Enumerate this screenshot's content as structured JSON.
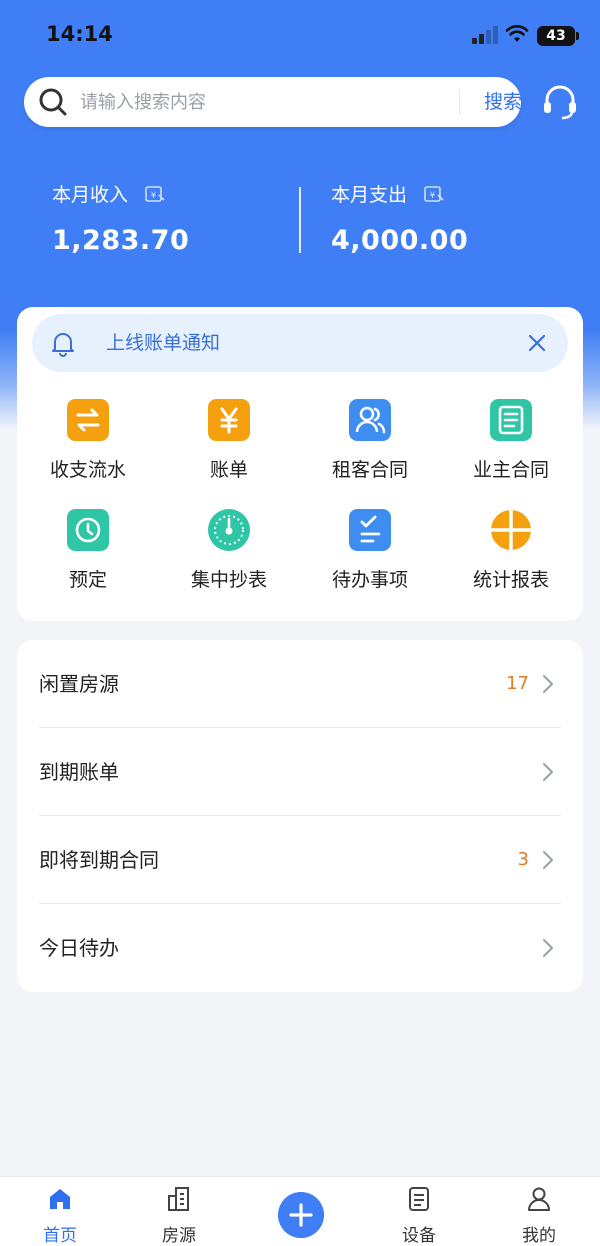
{
  "status_bar": {
    "time": "14:14",
    "battery": "43"
  },
  "search": {
    "placeholder": "请输入搜索内容",
    "button_label": "搜索"
  },
  "finance": {
    "income_label": "本月收入",
    "income_value": "1,283.70",
    "expense_label": "本月支出",
    "expense_value": "4,000.00"
  },
  "notice": {
    "text": "上线账单通知"
  },
  "quick_actions": [
    {
      "label": "收支流水",
      "icon": "transfer-icon",
      "color": "#f59a0c"
    },
    {
      "label": "账单",
      "icon": "yuan-icon",
      "color": "#f59a0c"
    },
    {
      "label": "租客合同",
      "icon": "tenant-icon",
      "color": "#3d8ef0"
    },
    {
      "label": "业主合同",
      "icon": "notebook-icon",
      "color": "#2fc6a6"
    },
    {
      "label": "预定",
      "icon": "clock-icon",
      "color": "#2fc6a6"
    },
    {
      "label": "集中抄表",
      "icon": "meter-icon",
      "color": "#2fc6a6"
    },
    {
      "label": "待办事项",
      "icon": "checklist-icon",
      "color": "#3d8ef0"
    },
    {
      "label": "统计报表",
      "icon": "pie-chart-icon",
      "color": "#f59a0c"
    }
  ],
  "list": [
    {
      "label": "闲置房源",
      "count": "17"
    },
    {
      "label": "到期账单",
      "count": ""
    },
    {
      "label": "即将到期合同",
      "count": "3"
    },
    {
      "label": "今日待办",
      "count": ""
    }
  ],
  "tab_bar": {
    "home": "首页",
    "houses": "房源",
    "devices": "设备",
    "mine": "我的"
  },
  "colors": {
    "primary": "#3f7ef4",
    "accent_orange": "#e07b24"
  }
}
